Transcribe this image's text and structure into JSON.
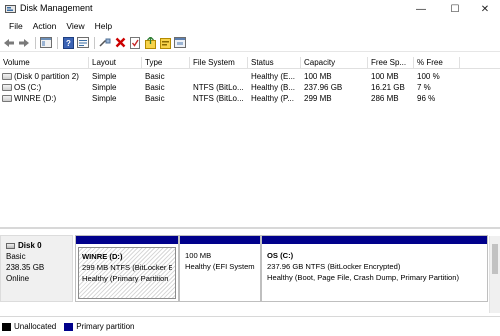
{
  "window": {
    "title": "Disk Management",
    "minimize": "—",
    "maximize": "☐",
    "close": "✕"
  },
  "menu": [
    "File",
    "Action",
    "View",
    "Help"
  ],
  "volume_table": {
    "columns": [
      "Volume",
      "Layout",
      "Type",
      "File System",
      "Status",
      "Capacity",
      "Free Sp...",
      "% Free"
    ],
    "rows": [
      [
        "(Disk 0 partition 2)",
        "Simple",
        "Basic",
        "",
        "Healthy (E...",
        "100 MB",
        "100 MB",
        "100 %"
      ],
      [
        "OS (C:)",
        "Simple",
        "Basic",
        "NTFS (BitLo...",
        "Healthy (B...",
        "237.96 GB",
        "16.21 GB",
        "7 %"
      ],
      [
        "WINRE (D:)",
        "Simple",
        "Basic",
        "NTFS (BitLo...",
        "Healthy (P...",
        "299 MB",
        "286 MB",
        "96 %"
      ]
    ]
  },
  "disk": {
    "name": "Disk 0",
    "type": "Basic",
    "size": "238.35 GB",
    "status": "Online",
    "partitions": [
      {
        "name": "WINRE  (D:)",
        "detail": "299 MB NTFS (BitLocker E",
        "health": "Healthy (Primary Partition"
      },
      {
        "name": "",
        "detail": "100 MB",
        "health": "Healthy (EFI System"
      },
      {
        "name": "OS  (C:)",
        "detail": "237.96 GB NTFS (BitLocker Encrypted)",
        "health": "Healthy (Boot, Page File, Crash Dump, Primary Partition)"
      }
    ]
  },
  "legend": [
    {
      "label": "Unallocated",
      "color": "#000000"
    },
    {
      "label": "Primary partition",
      "color": "#00008b"
    }
  ],
  "colors": {
    "partition_bar": "#00008b",
    "accent_red": "#cc0000"
  }
}
